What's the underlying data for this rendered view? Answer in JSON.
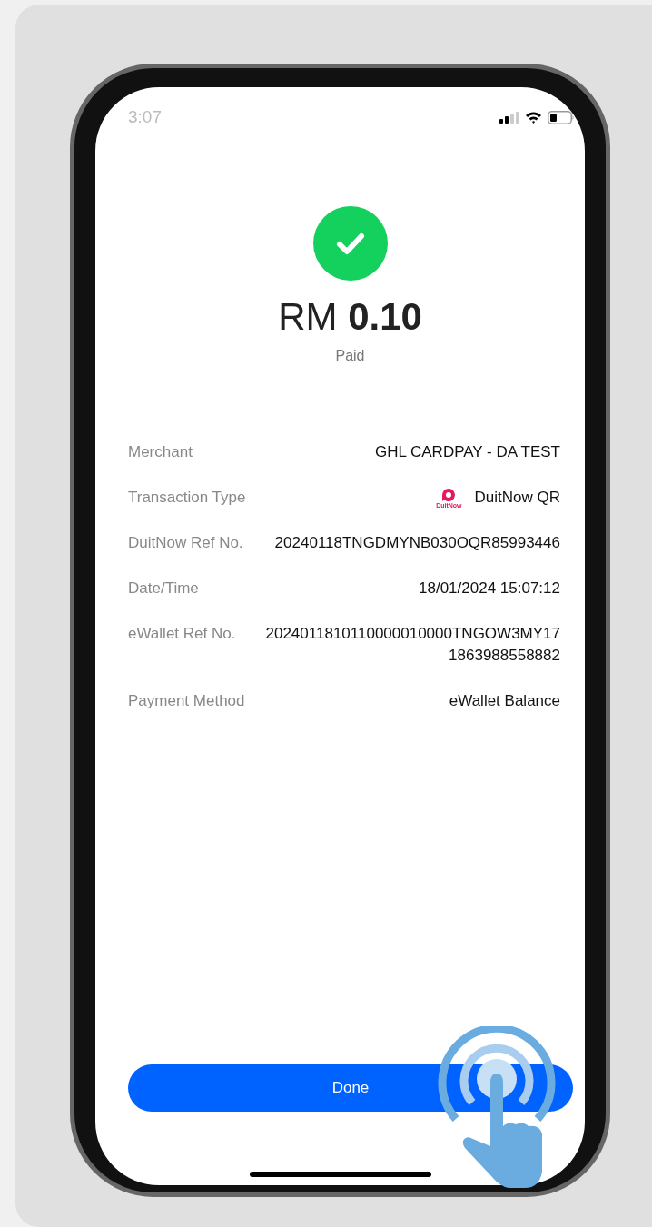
{
  "status_bar": {
    "time": "3:07"
  },
  "payment": {
    "currency": "RM",
    "amount": "0.10",
    "status": "Paid"
  },
  "details": [
    {
      "label": "Merchant",
      "value": "GHL CARDPAY - DA TEST"
    },
    {
      "label": "Transaction Type",
      "value": "DuitNow QR",
      "logo": {
        "label": "DuitNow"
      }
    },
    {
      "label": "DuitNow Ref No.",
      "value": "20240118TNGDMYNB030OQR85993446"
    },
    {
      "label": "Date/Time",
      "value": "18/01/2024 15:07:12"
    },
    {
      "label": "eWallet Ref No.",
      "value": "2024011810110000010000TNGOW3MY171863988558882"
    },
    {
      "label": "Payment Method",
      "value": "eWallet Balance"
    }
  ],
  "button": {
    "label": "Done"
  }
}
